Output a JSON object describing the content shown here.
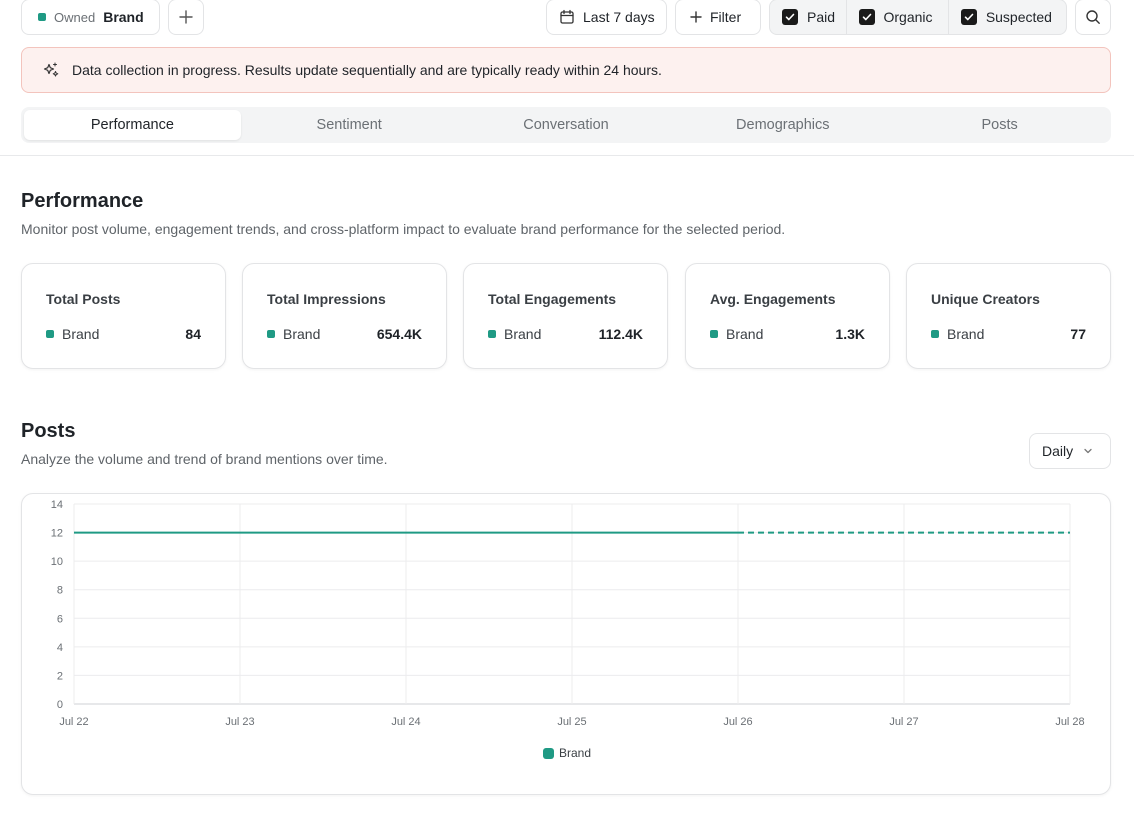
{
  "topbar": {
    "brand_chip": {
      "owned_label": "Owned",
      "brand_label": "Brand"
    },
    "date_range_label": "Last 7 days",
    "filter_label": "Filter",
    "toggles": [
      {
        "label": "Paid",
        "checked": true
      },
      {
        "label": "Organic",
        "checked": true
      },
      {
        "label": "Suspected",
        "checked": true
      }
    ]
  },
  "notice": {
    "text": "Data collection in progress. Results update sequentially and are typically ready within 24 hours."
  },
  "tabs": [
    {
      "label": "Performance",
      "active": true
    },
    {
      "label": "Sentiment",
      "active": false
    },
    {
      "label": "Conversation",
      "active": false
    },
    {
      "label": "Demographics",
      "active": false
    },
    {
      "label": "Posts",
      "active": false
    }
  ],
  "performance": {
    "title": "Performance",
    "subtitle": "Monitor post volume, engagement trends, and cross-platform impact to evaluate brand performance for the selected period.",
    "cards": [
      {
        "title": "Total Posts",
        "label": "Brand",
        "value": "84"
      },
      {
        "title": "Total Impressions",
        "label": "Brand",
        "value": "654.4K"
      },
      {
        "title": "Total Engagements",
        "label": "Brand",
        "value": "112.4K"
      },
      {
        "title": "Avg. Engagements",
        "label": "Brand",
        "value": "1.3K"
      },
      {
        "title": "Unique Creators",
        "label": "Brand",
        "value": "77"
      }
    ]
  },
  "posts": {
    "title": "Posts",
    "subtitle": "Analyze the volume and trend of brand mentions over time.",
    "interval_label": "Daily"
  },
  "colors": {
    "brand": "#1f9a84",
    "grid": "#ececee",
    "notice_bg": "#fdf1ef"
  },
  "chart_data": {
    "type": "line",
    "x": [
      "Jul 22",
      "Jul 23",
      "Jul 24",
      "Jul 25",
      "Jul 26",
      "Jul 27",
      "Jul 28"
    ],
    "series": [
      {
        "name": "Brand",
        "values": [
          12,
          12,
          12,
          12,
          12,
          12,
          12
        ],
        "dashed_from": "Jul 26"
      }
    ],
    "yticks": [
      0,
      2,
      4,
      6,
      8,
      10,
      12,
      14
    ],
    "ylim": [
      0,
      14
    ],
    "grid": true,
    "legend": "bottom-center"
  }
}
